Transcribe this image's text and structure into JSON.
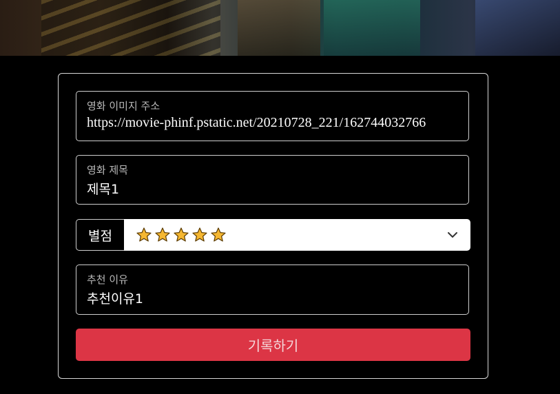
{
  "form": {
    "image_url": {
      "label": "영화 이미지 주소",
      "value": "https://movie-phinf.pstatic.net/20210728_221/162744032766"
    },
    "title": {
      "label": "영화 제목",
      "value": "제목1"
    },
    "rating": {
      "label": "별점",
      "selected": "⭐⭐⭐⭐⭐",
      "stars": 5,
      "star_color": "#f5b731",
      "icon": "chevron-down-icon"
    },
    "reason": {
      "label": "추천 이유",
      "value": "추천이유1"
    },
    "submit_label": "기록하기",
    "submit_color": "#dc3545"
  }
}
